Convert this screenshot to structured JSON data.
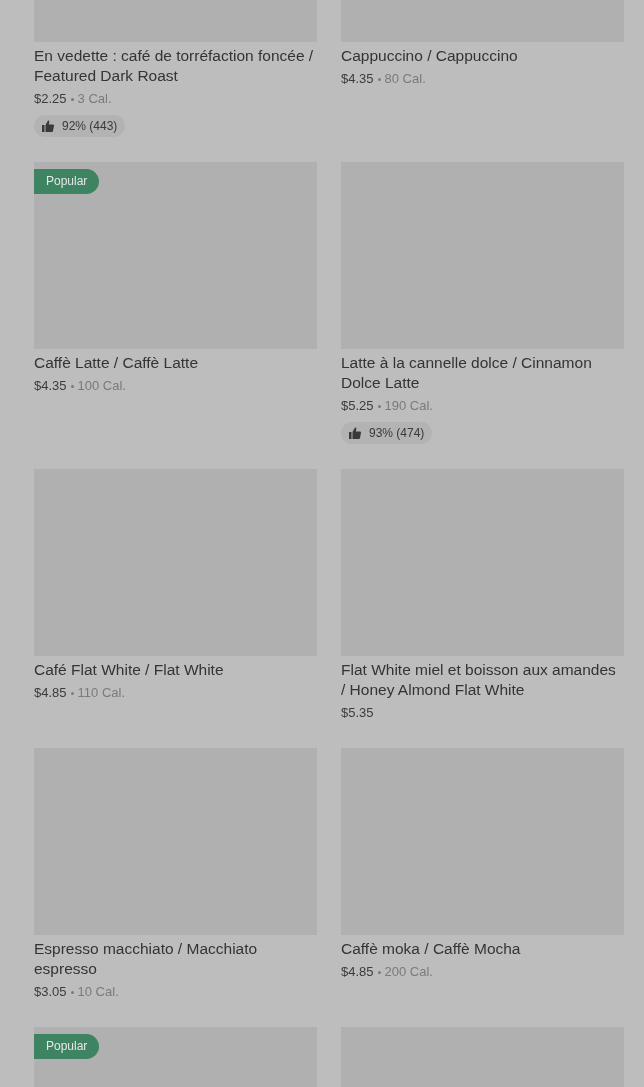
{
  "products": [
    {
      "kind": "product",
      "title": "En vedette : café de torréfaction foncée / Featured Dark Roast",
      "price": "$2.25",
      "calories": "3 Cal.",
      "rating": "92% (443)"
    },
    {
      "kind": "product",
      "title": "Cappuccino / Cappuccino",
      "price": "$4.35",
      "calories": "80 Cal."
    },
    {
      "kind": "product",
      "title": "Caffè Latte / Caffè Latte",
      "price": "$4.35",
      "calories": "100 Cal.",
      "badge": "Popular"
    },
    {
      "kind": "product",
      "title": "Latte à la cannelle dolce / Cinnamon Dolce Latte",
      "price": "$5.25",
      "calories": "190 Cal.",
      "rating": "93% (474)"
    },
    {
      "kind": "product",
      "title": "Café Flat White / Flat White",
      "price": "$4.85",
      "calories": "110 Cal."
    },
    {
      "kind": "product",
      "title": "Flat White miel et boisson aux amandes / Honey Almond Flat White",
      "price": "$5.35"
    },
    {
      "kind": "product",
      "title": "Espresso macchiato / Macchiato espresso",
      "price": "$3.05",
      "calories": "10 Cal."
    },
    {
      "kind": "product",
      "title": "Caffè moka / Caffè Mocha",
      "price": "$4.85",
      "calories": "200 Cal."
    },
    {
      "kind": "cut",
      "badge": "Popular"
    },
    {
      "kind": "cut"
    }
  ]
}
